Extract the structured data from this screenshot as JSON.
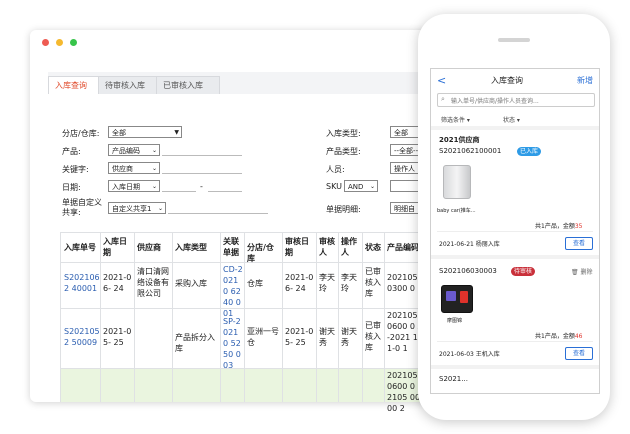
{
  "colors": {
    "accent": "#e04b2c",
    "link": "#2a5db0",
    "mobile_blue": "#2a6fd6",
    "badge_done": "#2e9be6",
    "badge_pending": "#c9303a",
    "green_row": "#eaf5df",
    "amount_red": "#e0322b"
  },
  "window": {
    "dots": [
      "#ee5b52",
      "#f5b92f",
      "#37c44a"
    ]
  },
  "tabs": [
    "入库查询",
    "待审核入库",
    "已审核入库"
  ],
  "filters": {
    "branch_label": "分店/仓库:",
    "branch_value": "全部",
    "product_label": "产品:",
    "product_value": "产品编码",
    "keyword_label": "关键字:",
    "keyword_value": "供应商",
    "date_label": "日期:",
    "date_value": "入库日期",
    "date_sep": "-",
    "custom_label": "单据自定义共享:",
    "custom_value": "自定义共享1",
    "type_label": "入库类型:",
    "type_value": "全部",
    "ptype_label": "产品类型:",
    "ptype_value": "--全部--",
    "person_label": "人员:",
    "person_value": "操作人",
    "sku_label": "SKU",
    "sku_value": "AND",
    "detail_label": "单据明细:",
    "detail_value": "明细自"
  },
  "table": {
    "headers": [
      "入库单号",
      "入库日期",
      "供应商",
      "入库类型",
      "关联单据",
      "分店/仓库",
      "审核日期",
      "审核人",
      "操作人",
      "状态",
      "产品编码"
    ],
    "rows": [
      [
        "S2021062 40001",
        "2021-06- 24",
        "清口清网 络设备有 限公司",
        "采购入库",
        "CD-2 0210 6240 001",
        "仓库",
        "2021-06- 24",
        "李天 玲",
        "李天 玲",
        "已审 核入 库",
        "202105 00300 0"
      ],
      [
        "S2021052 50009",
        "2021-05- 25",
        "",
        "产品拆分入库",
        "SP-2 0210 5250 003",
        "亚洲一号 仓",
        "2021-05- 25",
        "谢天 秀",
        "谢天 秀",
        "已审 核入 库",
        "202105 00600 0 sp-2021 1001-0 1"
      ],
      [
        "",
        "",
        "",
        "",
        "",
        "",
        "",
        "",
        "",
        "",
        "202105 00600 0 202105 00600 2"
      ]
    ]
  },
  "mobile": {
    "title": "入库查询",
    "back": "<",
    "new": "新增",
    "search_placeholder": "输入单号/供应商/操作人员查询...",
    "filter1": "筛选条件",
    "filter2": "状态",
    "card1": {
      "supplier": "2021供应商",
      "no": "S2021062100001",
      "status": "已入库",
      "item_name": "baby car(推车...",
      "summary_prefix": "共1产品，金额",
      "amount": "35",
      "date_op": "2021-06-21 杨丽入库",
      "view": "查看"
    },
    "card2": {
      "no": "S202106030003",
      "status": "待审核",
      "delete": "删除",
      "item_name": "摩图锦",
      "summary_prefix": "共1产品，金额",
      "amount": "46",
      "date_op": "2021-06-03 王机入库",
      "view": "查看"
    },
    "partial_no": "S2021..."
  }
}
